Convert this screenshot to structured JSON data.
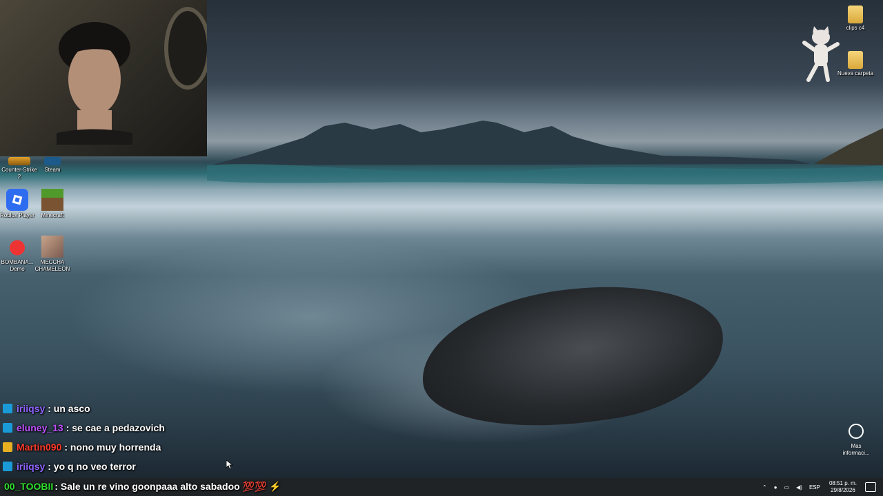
{
  "desktop_icons_left": [
    {
      "label": "Counter-Strike 2",
      "icon": "counter-strike-icon"
    },
    {
      "label": "Steam",
      "icon": "steam-icon"
    },
    {
      "label": "Roblox Player",
      "icon": "roblox-icon"
    },
    {
      "label": "Minecraft",
      "icon": "minecraft-icon"
    },
    {
      "label": "BOMBANA... Demo",
      "icon": "bombana-icon"
    },
    {
      "label": "MECCHA CHAMELEON",
      "icon": "meccha-icon"
    }
  ],
  "desktop_icons_right": [
    {
      "label": "clips c4",
      "icon": "folder-icon"
    },
    {
      "label": "Nueva carpeta",
      "icon": "folder-icon"
    }
  ],
  "more_info": {
    "label": "Mas informaci..."
  },
  "chat": [
    {
      "user": "iriiqsy",
      "text": ": un asco",
      "user_color": "#8f63ff",
      "badge": "prime"
    },
    {
      "user": "eluney_13",
      "text": ": se cae a pedazovich",
      "user_color": "#c050ff",
      "badge": "prime"
    },
    {
      "user": "Martin090",
      "text": ": nono muy horrenda",
      "user_color": "#ff3a2a",
      "badge": "crown"
    },
    {
      "user": "iriiqsy",
      "text": ": yo q no veo terror",
      "user_color": "#8f63ff",
      "badge": "prime"
    },
    {
      "user": "00_TOOBII",
      "text": ": Sale un re vino goonpaaa alto sabadoo 💯💯 ⚡",
      "user_color": "#2fe02f",
      "badge": "none"
    }
  ],
  "tray": {
    "language": "ESP",
    "time": "08:51 p. m.",
    "date": "29/8/2026"
  }
}
